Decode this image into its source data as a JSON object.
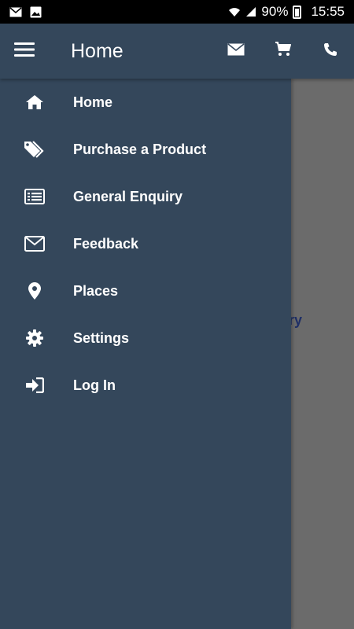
{
  "status_bar": {
    "battery": "90%",
    "time": "15:55"
  },
  "app_bar": {
    "title": "Home"
  },
  "background": {
    "partial_text": "quiry"
  },
  "drawer": {
    "items": [
      {
        "label": "Home",
        "icon": "home-icon"
      },
      {
        "label": "Purchase a Product",
        "icon": "tags-icon"
      },
      {
        "label": "General Enquiry",
        "icon": "list-icon"
      },
      {
        "label": "Feedback",
        "icon": "envelope-icon"
      },
      {
        "label": "Places",
        "icon": "map-pin-icon"
      },
      {
        "label": "Settings",
        "icon": "gear-icon"
      },
      {
        "label": "Log In",
        "icon": "sign-in-icon"
      }
    ]
  },
  "colors": {
    "primary": "#34475b",
    "scrim": "#6b6b6b",
    "status_bar": "#000000"
  }
}
